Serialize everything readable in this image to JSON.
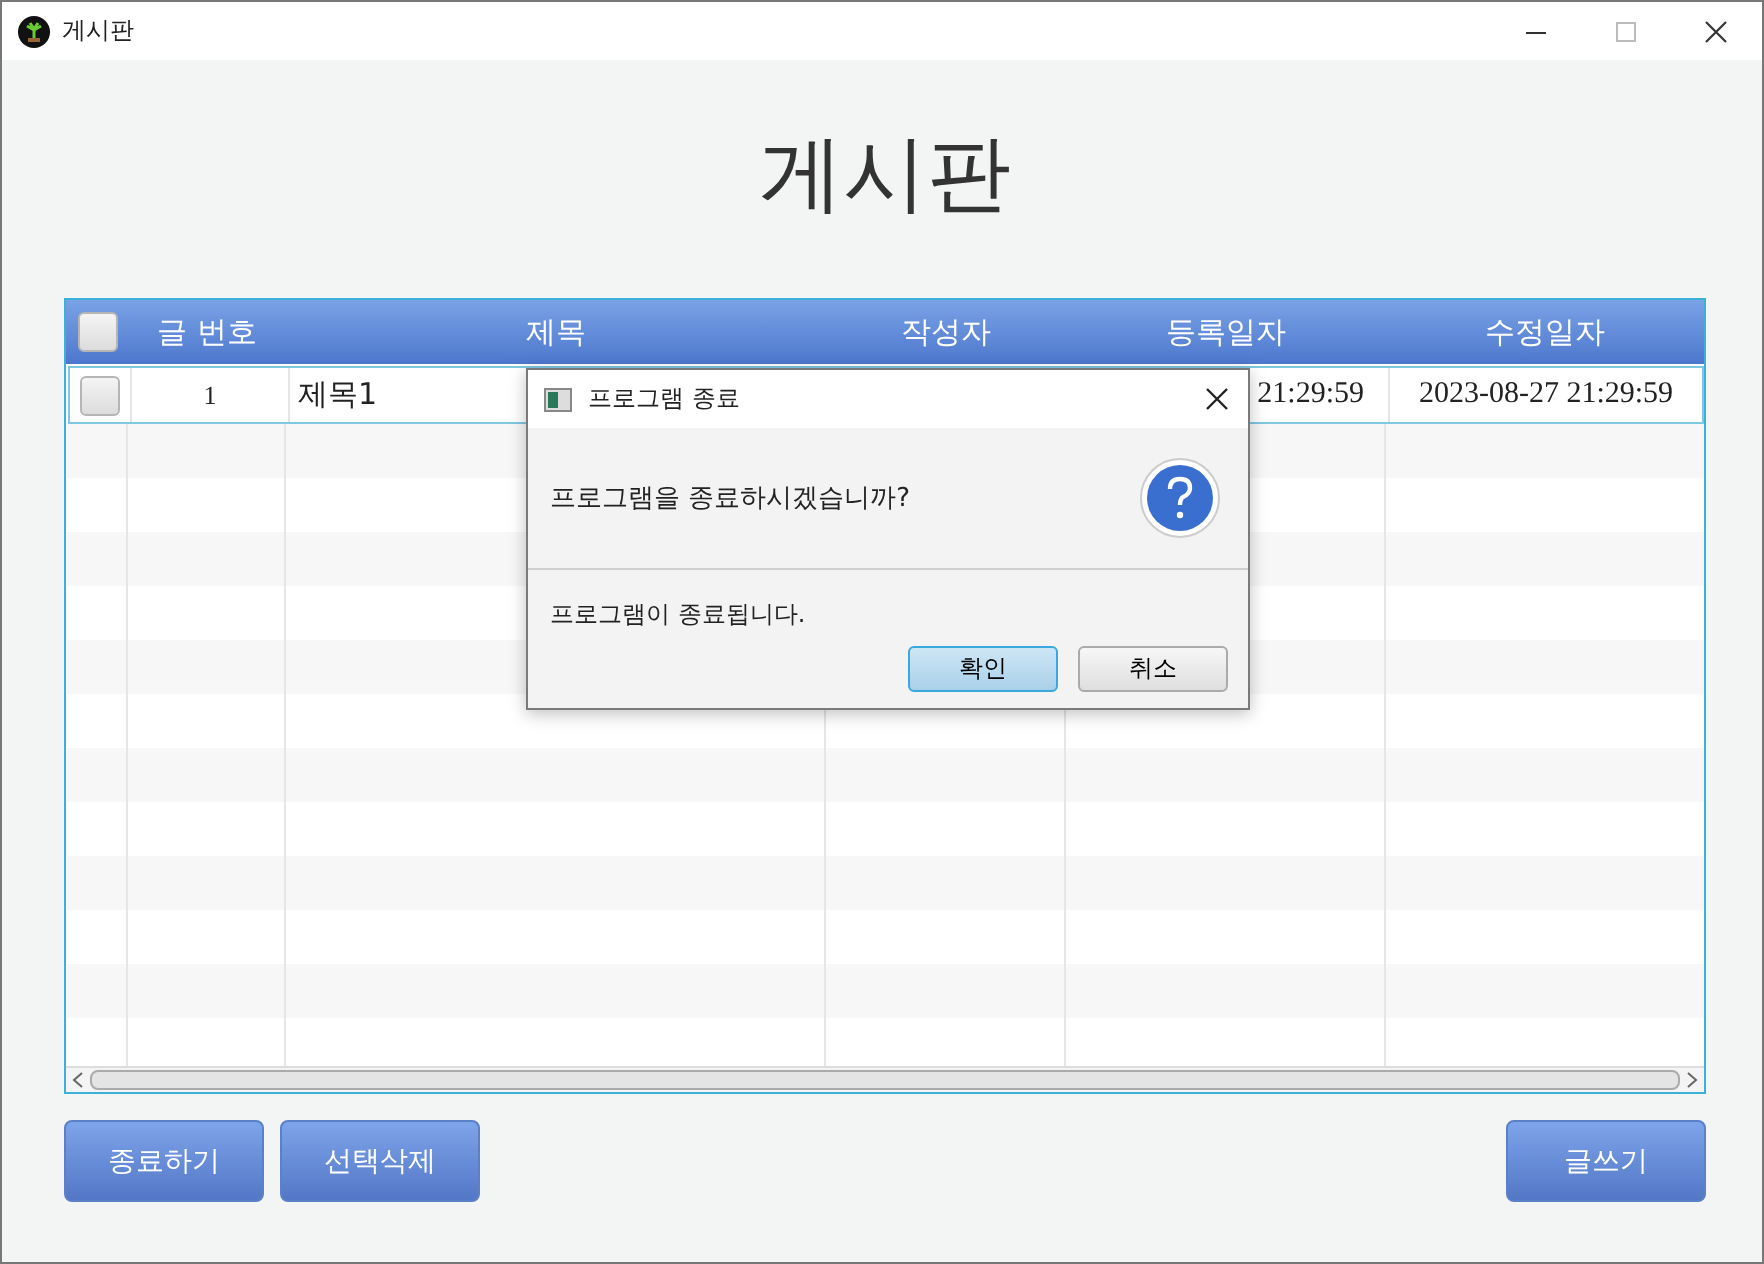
{
  "window": {
    "title": "게시판"
  },
  "heading": "게시판",
  "table": {
    "select_all": {
      "checked": false
    },
    "columns": [
      "글 번호",
      "제목",
      "작성자",
      "등록일자",
      "수정일자"
    ],
    "rows": [
      {
        "checked": false,
        "selected": true,
        "number": "1",
        "title": "제목1",
        "registered": "21:29:59",
        "modified": "2023-08-27 21:29:59"
      }
    ]
  },
  "buttons_left": [
    "종료하기",
    "선택삭제"
  ],
  "buttons_right": [
    "글쓰기"
  ],
  "dialog": {
    "title": "프로그램 종료",
    "message": "프로그램을 종료하시겠습니까?",
    "detail": "프로그램이 종료됩니다.",
    "buttons": [
      {
        "label": "확인",
        "default": true
      },
      {
        "label": "취소",
        "default": false
      }
    ]
  }
}
